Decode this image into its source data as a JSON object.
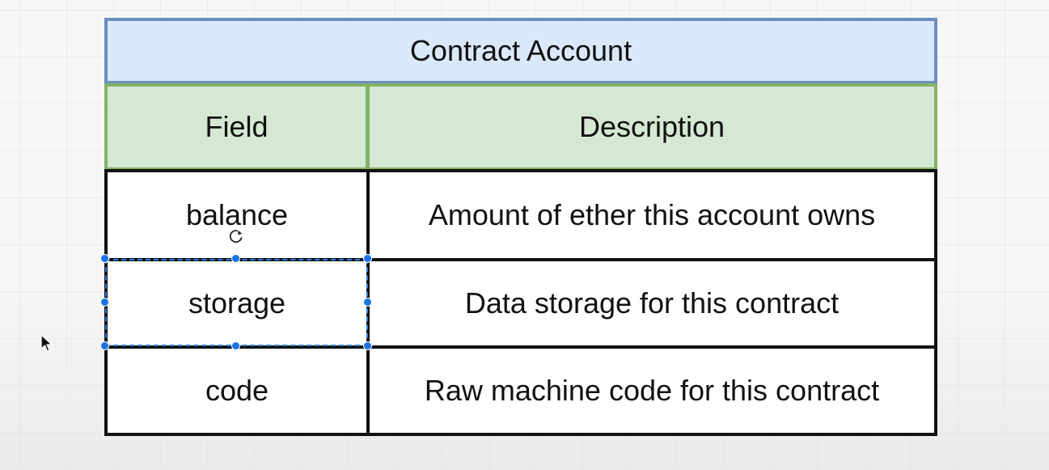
{
  "table": {
    "title": "Contract Account",
    "headers": {
      "field": "Field",
      "description": "Description"
    },
    "rows": [
      {
        "field": "balance",
        "description": "Amount of ether this account owns"
      },
      {
        "field": "storage",
        "description": "Data storage for this contract"
      },
      {
        "field": "code",
        "description": "Raw machine code for this contract"
      }
    ]
  },
  "selection": {
    "selected_cell": "storage"
  },
  "colors": {
    "title_fill": "#dae8fc",
    "title_stroke": "#6c8ebf",
    "header_fill": "#d5e8d4",
    "header_stroke": "#82b366",
    "body_stroke": "#111111",
    "selection": "#1a73e8"
  },
  "icons": {
    "rotate": "rotate-cursor-icon",
    "pointer": "mouse-pointer-icon"
  }
}
